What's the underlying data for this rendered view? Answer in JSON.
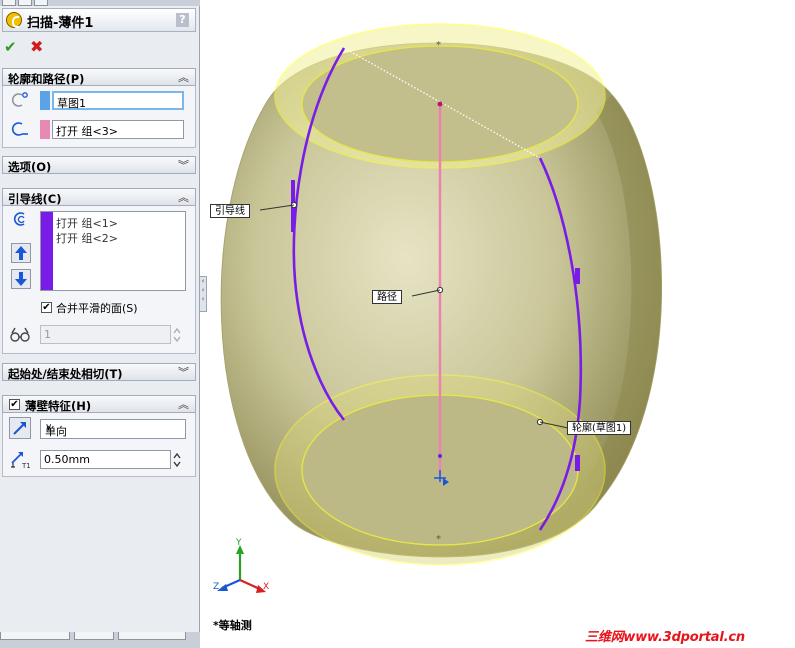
{
  "feature": {
    "title": "扫描-薄件1",
    "help": "?",
    "ok_glyph": "✔",
    "cancel_glyph": "✖"
  },
  "sections": {
    "profile_path": {
      "label": "轮廓和路径(P)",
      "chevron": "︽",
      "profile_value": "草图1",
      "path_value": "打开 组<3>",
      "profile_color": "#5aa3e8",
      "path_color": "#e889b3"
    },
    "options": {
      "label": "选项(O)",
      "chevron": "︾"
    },
    "guide_curves": {
      "label": "引导线(C)",
      "chevron": "︽",
      "items": [
        "打开 组<1>",
        "打开 组<2>"
      ],
      "list_color": "#7a1ce8",
      "merge_faces_label": "合并平滑的面(S)",
      "merge_faces_checked": "✔",
      "count_value": "1"
    },
    "tangency": {
      "label": "起始处/结束处相切(T)",
      "chevron": "︾"
    },
    "thin_feature": {
      "label": "薄壁特征(H)",
      "chevron": "︽",
      "checked": "✔",
      "type_value": "单向",
      "thickness_value": "0.50mm"
    }
  },
  "viewport": {
    "callouts": {
      "guide": "引导线",
      "path": "路径",
      "profile": "轮廓(草图1)"
    },
    "view_name": "*等轴测",
    "triad": {
      "x": "X",
      "y": "Y",
      "z": "Z"
    }
  },
  "watermark": "三维网www.3dportal.cn",
  "colors": {
    "body": "#c8c48e",
    "edge": "#ffff33",
    "guide": "#7a1ce8",
    "path": "#ee7fb0"
  }
}
